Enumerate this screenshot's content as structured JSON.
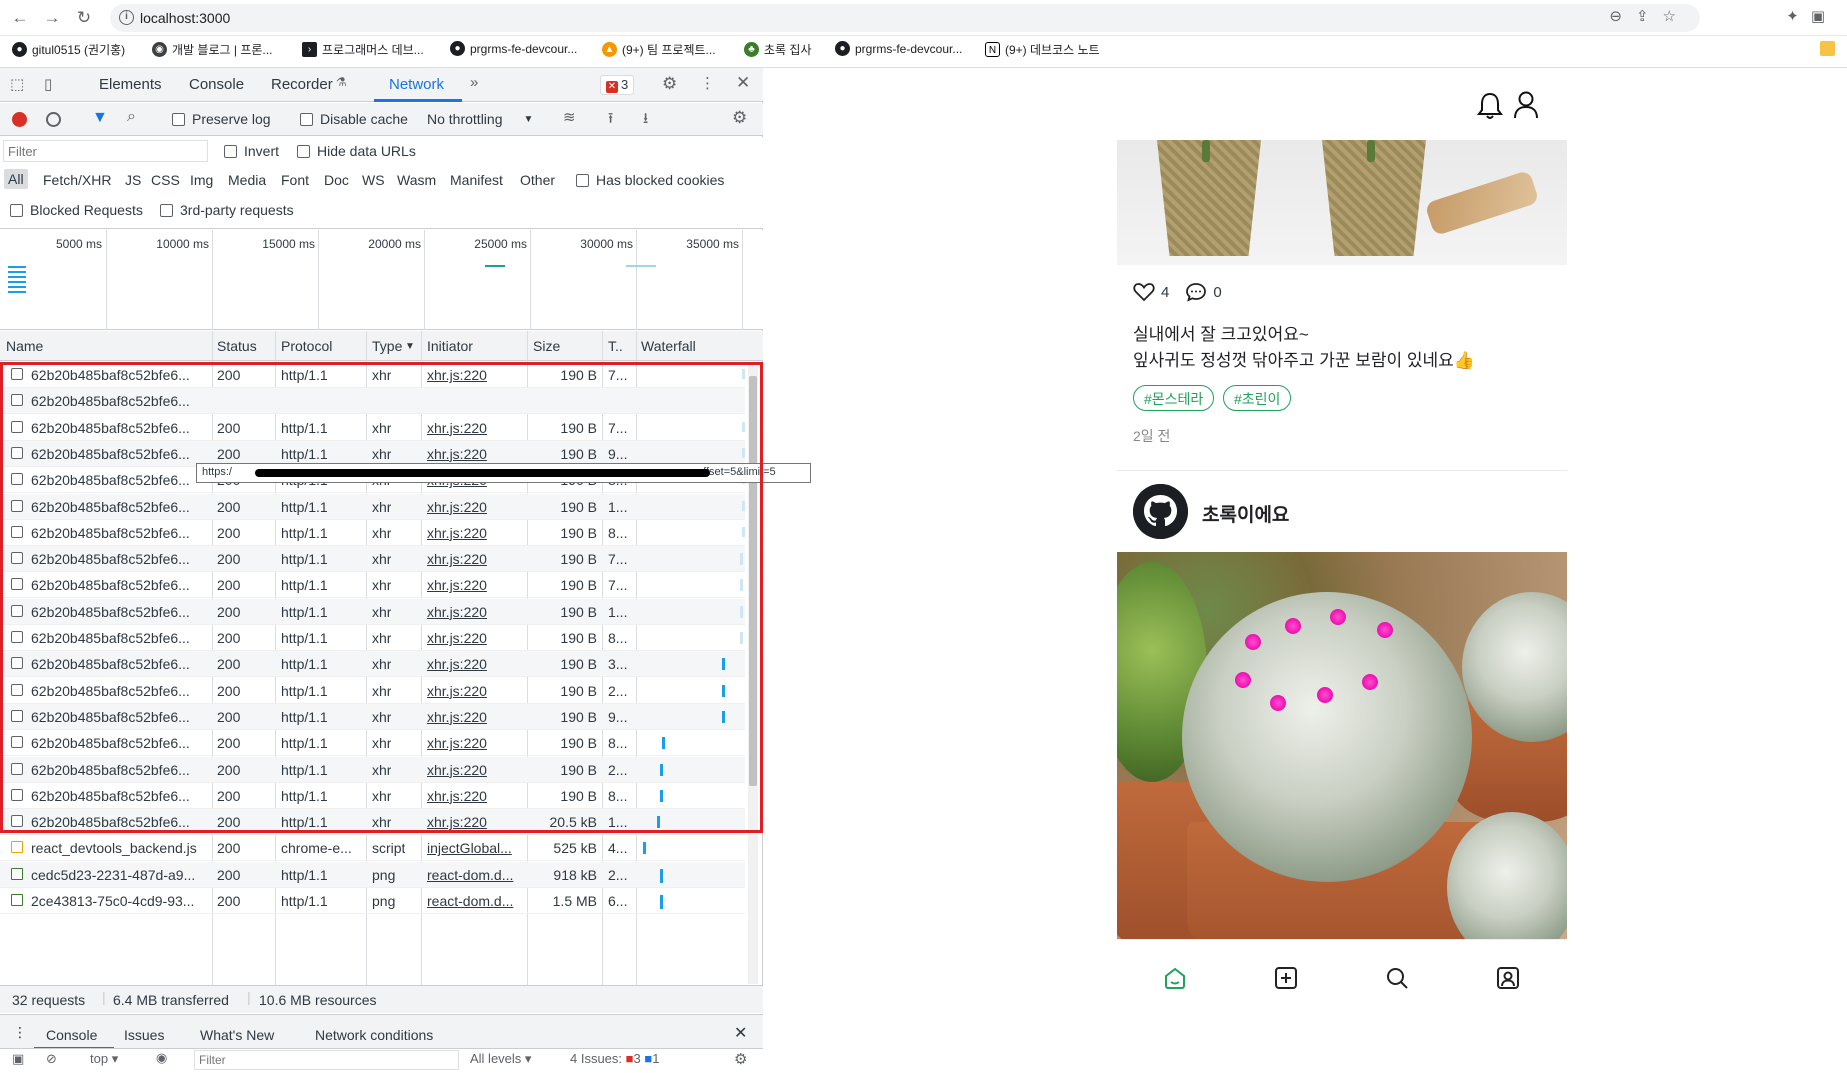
{
  "browser": {
    "url": "localhost:3000",
    "bookmarks": [
      {
        "label": "gitul0515 (권기홍)",
        "icon": "github-icon"
      },
      {
        "label": "개발 블로그 | 프론...",
        "icon": "globe-icon"
      },
      {
        "label": "프로그래머스 데브...",
        "icon": "programmers-icon"
      },
      {
        "label": "prgrms-fe-devcour...",
        "icon": "github-icon"
      },
      {
        "label": "(9+) 팀 프로젝트...",
        "icon": "fire-icon"
      },
      {
        "label": "초록 집사",
        "icon": "plant-icon"
      },
      {
        "label": "prgrms-fe-devcour...",
        "icon": "github-icon"
      },
      {
        "label": "(9+) 데브코스 노트",
        "icon": "notion-icon"
      }
    ]
  },
  "devtools": {
    "tabs": [
      "Elements",
      "Console",
      "Recorder",
      "Network"
    ],
    "active_tab": "Network",
    "error_count": "3",
    "toolbar": {
      "preserve_log": "Preserve log",
      "disable_cache": "Disable cache",
      "throttling": "No throttling"
    },
    "filter": {
      "placeholder": "Filter",
      "invert": "Invert",
      "hide_data_urls": "Hide data URLs",
      "types": [
        "All",
        "Fetch/XHR",
        "JS",
        "CSS",
        "Img",
        "Media",
        "Font",
        "Doc",
        "WS",
        "Wasm",
        "Manifest",
        "Other"
      ],
      "has_blocked_cookies": "Has blocked cookies",
      "blocked_requests": "Blocked Requests",
      "third_party": "3rd-party requests"
    },
    "overview_ticks": [
      "5000 ms",
      "10000 ms",
      "15000 ms",
      "20000 ms",
      "25000 ms",
      "30000 ms",
      "35000 ms"
    ],
    "columns": [
      "Name",
      "Status",
      "Protocol",
      "Type",
      "Initiator",
      "Size",
      "T..",
      "Waterfall"
    ],
    "rows": [
      {
        "name": "62b20b485baf8c52bfe6...",
        "status": "200",
        "protocol": "http/1.1",
        "type": "xhr",
        "initiator": "xhr.js:220",
        "size": "190 B",
        "time": "7..."
      },
      {
        "name": "62b20b485baf8c52bfe6...",
        "status": "",
        "protocol": "",
        "type": "",
        "initiator": "",
        "size": "",
        "time": ""
      },
      {
        "name": "62b20b485baf8c52bfe6...",
        "status": "200",
        "protocol": "http/1.1",
        "type": "xhr",
        "initiator": "xhr.js:220",
        "size": "190 B",
        "time": "7..."
      },
      {
        "name": "62b20b485baf8c52bfe6...",
        "status": "200",
        "protocol": "http/1.1",
        "type": "xhr",
        "initiator": "xhr.js:220",
        "size": "190 B",
        "time": "9..."
      },
      {
        "name": "62b20b485baf8c52bfe6...",
        "status": "200",
        "protocol": "http/1.1",
        "type": "xhr",
        "initiator": "xhr.js:220",
        "size": "190 B",
        "time": "8..."
      },
      {
        "name": "62b20b485baf8c52bfe6...",
        "status": "200",
        "protocol": "http/1.1",
        "type": "xhr",
        "initiator": "xhr.js:220",
        "size": "190 B",
        "time": "1..."
      },
      {
        "name": "62b20b485baf8c52bfe6...",
        "status": "200",
        "protocol": "http/1.1",
        "type": "xhr",
        "initiator": "xhr.js:220",
        "size": "190 B",
        "time": "8..."
      },
      {
        "name": "62b20b485baf8c52bfe6...",
        "status": "200",
        "protocol": "http/1.1",
        "type": "xhr",
        "initiator": "xhr.js:220",
        "size": "190 B",
        "time": "7..."
      },
      {
        "name": "62b20b485baf8c52bfe6...",
        "status": "200",
        "protocol": "http/1.1",
        "type": "xhr",
        "initiator": "xhr.js:220",
        "size": "190 B",
        "time": "7..."
      },
      {
        "name": "62b20b485baf8c52bfe6...",
        "status": "200",
        "protocol": "http/1.1",
        "type": "xhr",
        "initiator": "xhr.js:220",
        "size": "190 B",
        "time": "1..."
      },
      {
        "name": "62b20b485baf8c52bfe6...",
        "status": "200",
        "protocol": "http/1.1",
        "type": "xhr",
        "initiator": "xhr.js:220",
        "size": "190 B",
        "time": "8..."
      },
      {
        "name": "62b20b485baf8c52bfe6...",
        "status": "200",
        "protocol": "http/1.1",
        "type": "xhr",
        "initiator": "xhr.js:220",
        "size": "190 B",
        "time": "3..."
      },
      {
        "name": "62b20b485baf8c52bfe6...",
        "status": "200",
        "protocol": "http/1.1",
        "type": "xhr",
        "initiator": "xhr.js:220",
        "size": "190 B",
        "time": "2..."
      },
      {
        "name": "62b20b485baf8c52bfe6...",
        "status": "200",
        "protocol": "http/1.1",
        "type": "xhr",
        "initiator": "xhr.js:220",
        "size": "190 B",
        "time": "9..."
      },
      {
        "name": "62b20b485baf8c52bfe6...",
        "status": "200",
        "protocol": "http/1.1",
        "type": "xhr",
        "initiator": "xhr.js:220",
        "size": "190 B",
        "time": "8..."
      },
      {
        "name": "62b20b485baf8c52bfe6...",
        "status": "200",
        "protocol": "http/1.1",
        "type": "xhr",
        "initiator": "xhr.js:220",
        "size": "190 B",
        "time": "2..."
      },
      {
        "name": "62b20b485baf8c52bfe6...",
        "status": "200",
        "protocol": "http/1.1",
        "type": "xhr",
        "initiator": "xhr.js:220",
        "size": "190 B",
        "time": "8..."
      },
      {
        "name": "62b20b485baf8c52bfe6...",
        "status": "200",
        "protocol": "http/1.1",
        "type": "xhr",
        "initiator": "xhr.js:220",
        "size": "20.5 kB",
        "time": "1..."
      },
      {
        "name": "react_devtools_backend.js",
        "status": "200",
        "protocol": "chrome-e...",
        "type": "script",
        "initiator": "injectGlobal...",
        "size": "525 kB",
        "time": "4..."
      },
      {
        "name": "cedc5d23-2231-487d-a9...",
        "status": "200",
        "protocol": "http/1.1",
        "type": "png",
        "initiator": "react-dom.d...",
        "size": "918 kB",
        "time": "2..."
      },
      {
        "name": "2ce43813-75c0-4cd9-93...",
        "status": "200",
        "protocol": "http/1.1",
        "type": "png",
        "initiator": "react-dom.d...",
        "size": "1.5 MB",
        "time": "6..."
      }
    ],
    "tooltip_start": "https:/",
    "tooltip_end": "offset=5&limit=5",
    "summary": {
      "requests": "32 requests",
      "transferred": "6.4 MB transferred",
      "resources": "10.6 MB resources"
    },
    "drawer_tabs": [
      "Console",
      "Issues",
      "What's New",
      "Network conditions"
    ],
    "console_bar": {
      "context": "top",
      "filter_placeholder": "Filter",
      "levels": "All levels",
      "issues": "4 Issues:",
      "issues_errors": "3",
      "issues_info": "1"
    }
  },
  "app": {
    "post1": {
      "likes": "4",
      "comments": "0",
      "text_line1": "실내에서 잘 크고있어요~",
      "text_line2": "잎사귀도 정성껏 닦아주고 가꾼 보람이 있네요👍",
      "tags": [
        "#몬스테라",
        "#초린이"
      ],
      "time": "2일 전"
    },
    "post2": {
      "username": "초록이에요"
    },
    "colors": {
      "accent_green": "#1ea35a",
      "highlight_red": "#e01e25",
      "devtools_blue": "#1a73e8"
    }
  }
}
